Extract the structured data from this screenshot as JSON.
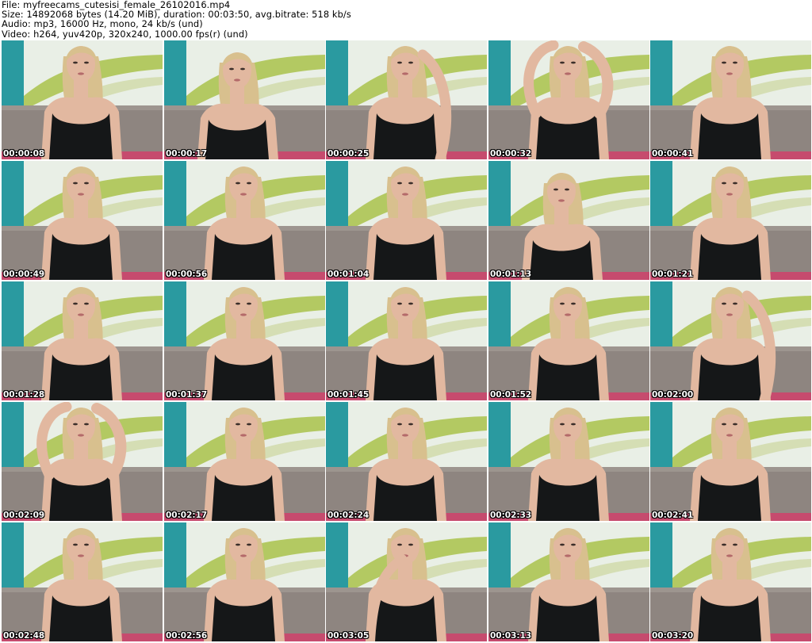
{
  "header": {
    "file": "File: myfreecams_cutesisi_female_26102016.mp4",
    "size": "Size: 14892068 bytes (14.20 MiB), duration: 00:03:50, avg.bitrate: 518 kb/s",
    "audio": "Audio: mp3, 16000 Hz, mono, 24 kb/s (und)",
    "video": "Video: h264, yuv420p, 320x240, 1000.00 fps(r) (und)"
  },
  "colors": {
    "wall_teal": "#2a9aa0",
    "poster_light": "#e9efe6",
    "poster_green": "#a9c24a",
    "sofa_gray": "#8e8580",
    "tank_top": "#151718",
    "skin": "#e2b8a0",
    "hair": "#d8c08e",
    "cushion_pink": "#d83868"
  },
  "thumbnails": [
    {
      "time": "00:00:08",
      "pose": "neutral"
    },
    {
      "time": "00:00:17",
      "pose": "lean"
    },
    {
      "time": "00:00:25",
      "pose": "hand-hair"
    },
    {
      "time": "00:00:32",
      "pose": "arm-up"
    },
    {
      "time": "00:00:41",
      "pose": "neutral"
    },
    {
      "time": "00:00:49",
      "pose": "neutral"
    },
    {
      "time": "00:00:56",
      "pose": "neutral"
    },
    {
      "time": "00:01:04",
      "pose": "neutral"
    },
    {
      "time": "00:01:13",
      "pose": "lean"
    },
    {
      "time": "00:01:21",
      "pose": "neutral"
    },
    {
      "time": "00:01:28",
      "pose": "neutral"
    },
    {
      "time": "00:01:37",
      "pose": "neutral"
    },
    {
      "time": "00:01:45",
      "pose": "neutral"
    },
    {
      "time": "00:01:52",
      "pose": "neutral"
    },
    {
      "time": "00:02:00",
      "pose": "hand-hair"
    },
    {
      "time": "00:02:09",
      "pose": "arm-up"
    },
    {
      "time": "00:02:17",
      "pose": "neutral"
    },
    {
      "time": "00:02:24",
      "pose": "neutral"
    },
    {
      "time": "00:02:33",
      "pose": "neutral"
    },
    {
      "time": "00:02:41",
      "pose": "neutral"
    },
    {
      "time": "00:02:48",
      "pose": "neutral"
    },
    {
      "time": "00:02:56",
      "pose": "neutral"
    },
    {
      "time": "00:03:05",
      "pose": "hand-chin"
    },
    {
      "time": "00:03:13",
      "pose": "neutral"
    },
    {
      "time": "00:03:20",
      "pose": "neutral"
    }
  ]
}
